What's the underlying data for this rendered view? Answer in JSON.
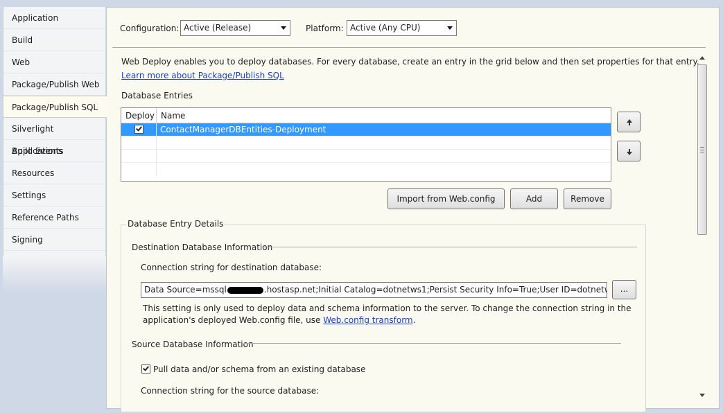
{
  "sidebar": {
    "items": [
      {
        "label": "Application"
      },
      {
        "label": "Build"
      },
      {
        "label": "Web"
      },
      {
        "label": "Package/Publish Web"
      },
      {
        "label": "Package/Publish SQL"
      },
      {
        "label": "Silverlight Applications"
      },
      {
        "label": "Build Events"
      },
      {
        "label": "Resources"
      },
      {
        "label": "Settings"
      },
      {
        "label": "Reference Paths"
      },
      {
        "label": "Signing"
      }
    ]
  },
  "config": {
    "configuration_label": "Configuration:",
    "configuration_value": "Active (Release)",
    "platform_label": "Platform:",
    "platform_value": "Active (Any CPU)"
  },
  "intro": {
    "description": "Web Deploy enables you to deploy databases. For every database, create an entry in the grid below and then set properties for that entry.",
    "learn_more": "Learn more about Package/Publish SQL"
  },
  "entries": {
    "title": "Database Entries",
    "columns": [
      "Deploy",
      "Name"
    ],
    "rows": [
      {
        "deploy": true,
        "name": "ContactManagerDBEntities-Deployment"
      }
    ],
    "buttons": {
      "import": "Import from Web.config",
      "add": "Add",
      "remove": "Remove"
    }
  },
  "details": {
    "title": "Database Entry Details",
    "destination": {
      "title": "Destination Database Information",
      "conn_label": "Connection string for destination database:",
      "conn_prefix": "Data Source=mssql",
      "conn_suffix": ".hostasp.net;Initial Catalog=dotnetws1;Persist Security Info=True;User ID=dotnetws;Password=dc",
      "browse_label": "...",
      "note_line1": "This setting is only used to deploy data and schema information to the server. To change the connection string in the",
      "note_line2": "application's deployed Web.config file, use",
      "note_link": "Web.config transform",
      "note_end": "."
    },
    "source": {
      "title": "Source Database Information",
      "pull_label": "Pull data and/or schema from an existing database",
      "pull_checked": true,
      "conn_label": "Connection string for the source database:"
    }
  },
  "colors": {
    "selection": "#3399ff",
    "link": "#1a3fbf",
    "panel": "#fbfaf0",
    "background": "#cfd8e6"
  }
}
